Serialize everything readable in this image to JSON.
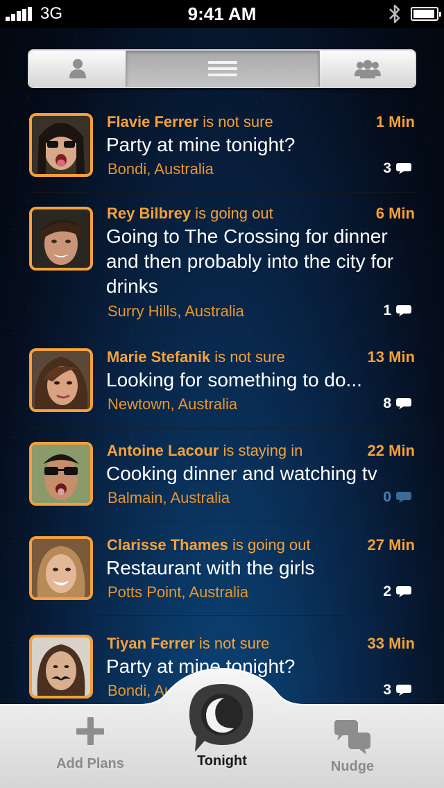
{
  "status_bar": {
    "network": "3G",
    "time": "9:41 AM"
  },
  "segmented": {
    "items": [
      {
        "icon": "person-icon"
      },
      {
        "icon": "list-icon",
        "selected": true
      },
      {
        "icon": "group-icon"
      }
    ]
  },
  "feed": [
    {
      "name": "Flavie Ferrer",
      "status": " is not sure",
      "time": "1 Min",
      "text": "Party at mine tonight?",
      "location": "Bondi, Australia",
      "comments": "3"
    },
    {
      "name": "Rey Bilbrey",
      "status": " is going out",
      "time": "6 Min",
      "text": "Going to The Crossing for dinner and then probably into the city for drinks",
      "location": "Surry Hills, Australia",
      "comments": "1"
    },
    {
      "name": "Marie Stefanik",
      "status": " is not sure",
      "time": "13 Min",
      "text": "Looking for something to do...",
      "location": "Newtown, Australia",
      "comments": "8"
    },
    {
      "name": "Antoine Lacour",
      "status": " is staying in",
      "time": "22 Min",
      "text": "Cooking dinner and watching tv",
      "location": "Balmain, Australia",
      "comments": "0"
    },
    {
      "name": "Clarisse Thames",
      "status": " is going out",
      "time": "27 Min",
      "text": "Restaurant with the girls",
      "location": "Potts Point, Australia",
      "comments": "2"
    },
    {
      "name": "Tiyan Ferrer",
      "status": " is not sure",
      "time": "33 Min",
      "text": "Party at mine tonight?",
      "location": "Bondi, Australia",
      "comments": "3"
    }
  ],
  "tab_bar": {
    "add_plans": "Add Plans",
    "tonight": "Tonight",
    "nudge": "Nudge"
  },
  "colors": {
    "accent": "#f5a13a",
    "background": "#08203f"
  }
}
